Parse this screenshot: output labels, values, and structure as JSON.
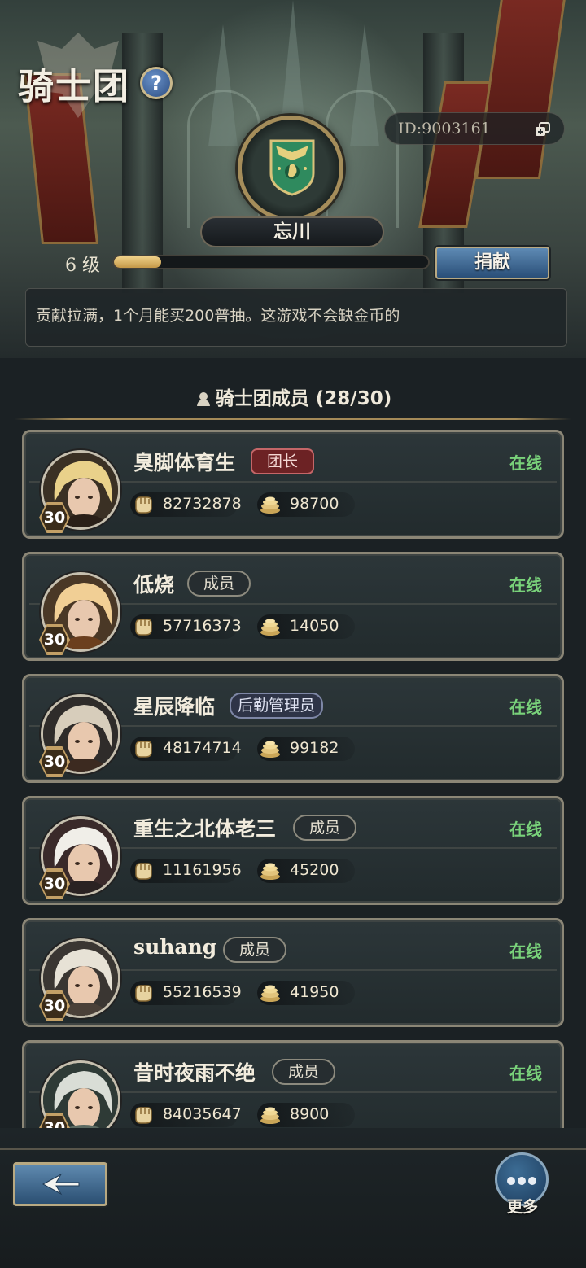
{
  "header": {
    "title": "骑士团",
    "help_label": "?",
    "id_text": "ID:9003161",
    "guild_name": "忘川",
    "level_text": "6 级",
    "level_progress": 0.15,
    "donate_label": "捐献",
    "notice": "贡献拉满，1个月能买200普抽。这游戏不会缺金币的"
  },
  "members": {
    "title": "骑士团成员 (28/30)",
    "items": [
      {
        "name": "臭脚体育生",
        "role": "团长",
        "role_type": "leader",
        "status": "在线",
        "level": "30",
        "power": "82732878",
        "coins": "98700"
      },
      {
        "name": "低烧",
        "role": "成员",
        "role_type": "member",
        "status": "在线",
        "level": "30",
        "power": "57716373",
        "coins": "14050"
      },
      {
        "name": "星辰降临",
        "role": "后勤管理员",
        "role_type": "logi",
        "status": "在线",
        "level": "30",
        "power": "48174714",
        "coins": "99182"
      },
      {
        "name": "重生之北体老三",
        "role": "成员",
        "role_type": "member",
        "status": "在线",
        "level": "30",
        "power": "11161956",
        "coins": "45200"
      },
      {
        "name": "suhang",
        "role": "成员",
        "role_type": "member",
        "status": "在线",
        "level": "30",
        "power": "55216539",
        "coins": "41950"
      },
      {
        "name": "昔时夜雨不绝",
        "role": "成员",
        "role_type": "member",
        "status": "在线",
        "level": "30",
        "power": "84035647",
        "coins": "8900"
      }
    ]
  },
  "footer": {
    "more_label": "更多"
  },
  "colors": {
    "online": "#79d27a",
    "leader_badge": "#6c2224",
    "accent_gold": "#c49848",
    "button_blue": "#2a4f78"
  },
  "icons": {
    "help": "question-icon",
    "copy": "copy-icon",
    "power": "fist-icon",
    "coins": "coin-stack-icon",
    "back": "back-arrow-icon",
    "more": "more-dots-icon"
  }
}
